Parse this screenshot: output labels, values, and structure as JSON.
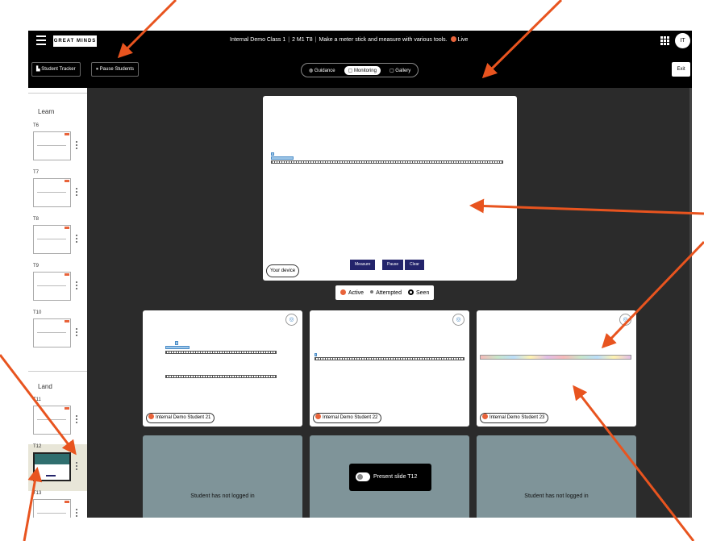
{
  "topbar": {
    "logo": "GREAT MINDS",
    "class_name": "Internal Demo Class 1",
    "lesson_code": "2 M1 T8",
    "lesson_title": "Make a meter stick and measure with various tools.",
    "live_label": "Live",
    "avatar_initials": "IT"
  },
  "toolbar": {
    "student_tracker": "Student Tracker",
    "pause_students": "Pause Students",
    "tabs": [
      "Guidance",
      "Monitoring",
      "Gallery"
    ],
    "active_tab": "Monitoring",
    "exit": "Exit"
  },
  "sidebar": {
    "learn_label": "Learn",
    "land_label": "Land",
    "learn_items": [
      "T6",
      "T7",
      "T8",
      "T9",
      "T10"
    ],
    "land_items": [
      "T11",
      "T12",
      "T13"
    ],
    "selected_item": "T12"
  },
  "preview": {
    "your_device": "Your device",
    "buttons": [
      "Measure",
      "Pause",
      "Clear"
    ]
  },
  "legend": {
    "active": "Active",
    "attempted": "Attempted",
    "seen": "Seen"
  },
  "students": [
    {
      "name": "Internal Demo Student 21"
    },
    {
      "name": "Internal Demo Student 22"
    },
    {
      "name": "Internal Demo Student 23"
    }
  ],
  "offline_message": "Student has not logged in",
  "present_slide": "Present slide T12",
  "colors": {
    "accent": "#e8633a",
    "navy_button": "#23246b",
    "teal": "#2f6e6e",
    "workspace": "#2b2b2b"
  }
}
